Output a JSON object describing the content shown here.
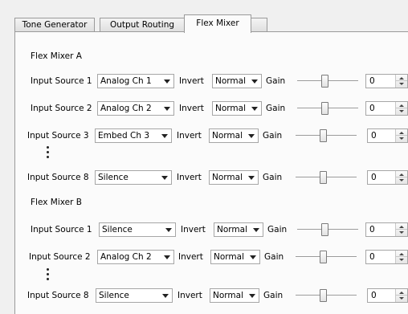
{
  "tabs": [
    {
      "label": "Tone Generator"
    },
    {
      "label": "Output Routing"
    },
    {
      "label": "Flex Mixer",
      "active": true
    }
  ],
  "labels": {
    "invert": "Invert",
    "gain": "Gain"
  },
  "mixer_a": {
    "title": "Flex Mixer A",
    "rows": [
      {
        "label": "Input Source 1",
        "source": "Analog Ch 1",
        "invert": "Normal",
        "gain": "0",
        "slider_level": 0.45
      },
      {
        "label": "Input Source 2",
        "source": "Analog Ch 2",
        "invert": "Normal",
        "gain": "0",
        "slider_level": 0.45
      },
      {
        "label": "Input Source 3",
        "source": "Embed Ch 3",
        "invert": "Normal",
        "gain": "0",
        "slider_level": 0.45
      },
      {
        "label": "Input Source 8",
        "source": "Silence",
        "invert": "Normal",
        "gain": "0",
        "slider_level": 0.45
      }
    ]
  },
  "mixer_b": {
    "title": "Flex Mixer B",
    "rows": [
      {
        "label": "Input Source 1",
        "source": "Silence",
        "invert": "Normal",
        "gain": "0",
        "slider_level": 0.45
      },
      {
        "label": "Input Source 2",
        "source": "Analog Ch 2",
        "invert": "Normal",
        "gain": "0",
        "slider_level": 0.45
      },
      {
        "label": "Input Source 8",
        "source": "Silence",
        "invert": "Normal",
        "gain": "0",
        "slider_level": 0.45
      }
    ]
  }
}
